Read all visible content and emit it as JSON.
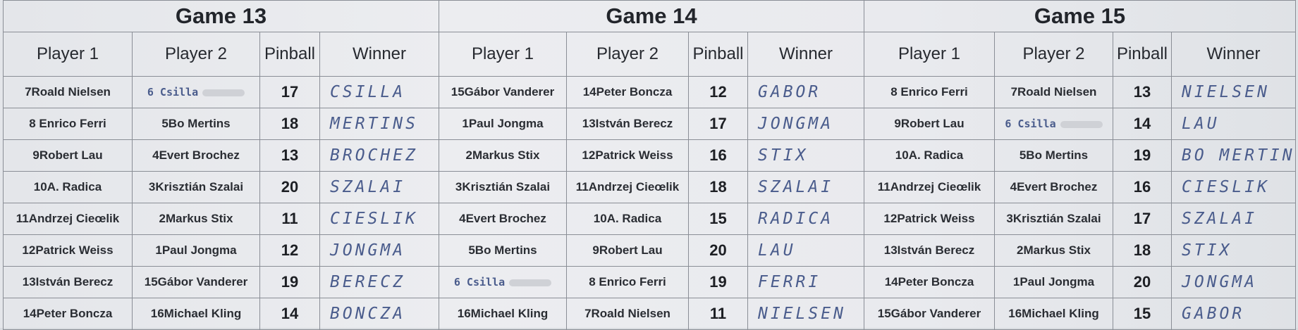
{
  "games": [
    {
      "title": "Game 13",
      "headers": [
        "Player 1",
        "Player 2",
        "Pinball",
        "Winner"
      ],
      "rows": [
        {
          "p1": "7Roald Nielsen",
          "p2": "6 Csilla",
          "pinball": "17",
          "winner": "CSILLA"
        },
        {
          "p1": "8 Enrico Ferri",
          "p2": "5Bo Mertins",
          "pinball": "18",
          "winner": "MERTINS"
        },
        {
          "p1": "9Robert Lau",
          "p2": "4Evert Brochez",
          "pinball": "13",
          "winner": "BROCHEZ"
        },
        {
          "p1": "10A. Radica",
          "p2": "3Krisztián Szalai",
          "pinball": "20",
          "winner": "SZALAI"
        },
        {
          "p1": "11Andrzej Cieœlik",
          "p2": "2Markus Stix",
          "pinball": "11",
          "winner": "CIESLIK"
        },
        {
          "p1": "12Patrick Weiss",
          "p2": "1Paul Jongma",
          "pinball": "12",
          "winner": "JONGMA"
        },
        {
          "p1": "13István Berecz",
          "p2": "15Gábor Vanderer",
          "pinball": "19",
          "winner": "BERECZ"
        },
        {
          "p1": "14Peter Boncza",
          "p2": "16Michael Kling",
          "pinball": "14",
          "winner": "BONCZA"
        }
      ]
    },
    {
      "title": "Game 14",
      "headers": [
        "Player 1",
        "Player 2",
        "Pinball",
        "Winner"
      ],
      "rows": [
        {
          "p1": "15Gábor Vanderer",
          "p2": "14Peter Boncza",
          "pinball": "12",
          "winner": "GABOR"
        },
        {
          "p1": "1Paul Jongma",
          "p2": "13István Berecz",
          "pinball": "17",
          "winner": "JONGMA"
        },
        {
          "p1": "2Markus Stix",
          "p2": "12Patrick Weiss",
          "pinball": "16",
          "winner": "STIX"
        },
        {
          "p1": "3Krisztián Szalai",
          "p2": "11Andrzej Cieœlik",
          "pinball": "18",
          "winner": "SZALAI"
        },
        {
          "p1": "4Evert Brochez",
          "p2": "10A. Radica",
          "pinball": "15",
          "winner": "RADICA"
        },
        {
          "p1": "5Bo Mertins",
          "p2": "9Robert Lau",
          "pinball": "20",
          "winner": "LAU"
        },
        {
          "p1": "6 Csilla",
          "p2": "8 Enrico Ferri",
          "pinball": "19",
          "winner": "FERRI"
        },
        {
          "p1": "16Michael Kling",
          "p2": "7Roald Nielsen",
          "pinball": "11",
          "winner": "NIELSEN"
        }
      ]
    },
    {
      "title": "Game 15",
      "headers": [
        "Player 1",
        "Player 2",
        "Pinball",
        "Winner"
      ],
      "rows": [
        {
          "p1": "8 Enrico Ferri",
          "p2": "7Roald Nielsen",
          "pinball": "13",
          "winner": "NIELSEN"
        },
        {
          "p1": "9Robert Lau",
          "p2": "6 Csilla",
          "pinball": "14",
          "winner": "LAU"
        },
        {
          "p1": "10A. Radica",
          "p2": "5Bo Mertins",
          "pinball": "19",
          "winner": "BO MERTINS"
        },
        {
          "p1": "11Andrzej Cieœlik",
          "p2": "4Evert Brochez",
          "pinball": "16",
          "winner": "CIESLIK"
        },
        {
          "p1": "12Patrick Weiss",
          "p2": "3Krisztián Szalai",
          "pinball": "17",
          "winner": "SZALAI"
        },
        {
          "p1": "13István Berecz",
          "p2": "2Markus Stix",
          "pinball": "18",
          "winner": "STIX"
        },
        {
          "p1": "14Peter Boncza",
          "p2": "1Paul Jongma",
          "pinball": "20",
          "winner": "JONGMA"
        },
        {
          "p1": "15Gábor Vanderer",
          "p2": "16Michael Kling",
          "pinball": "15",
          "winner": "GABOR"
        }
      ]
    }
  ]
}
